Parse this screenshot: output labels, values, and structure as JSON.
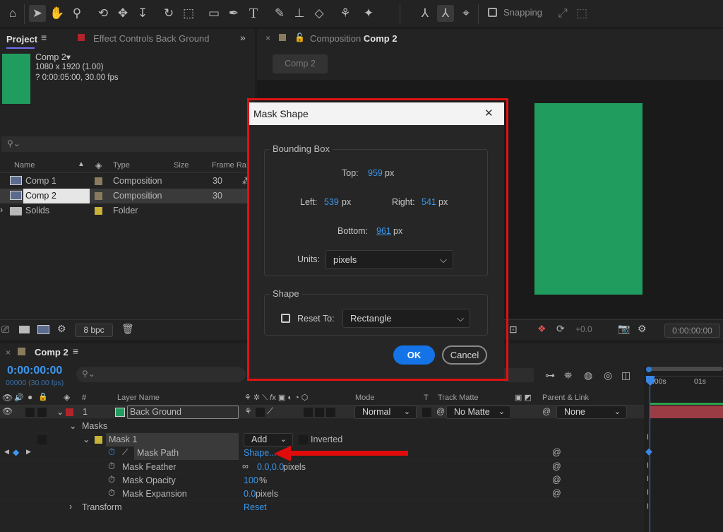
{
  "toolbar": {
    "snapping_label": "Snapping"
  },
  "project_panel": {
    "tab_project": "Project",
    "tab_effect_controls": "Effect Controls Back Ground",
    "comp_name": "Comp 2",
    "comp_resolution": "1080 x 1920 (1.00)",
    "comp_duration": "? 0:00:05:00, 30.00 fps",
    "search_placeholder": "",
    "columns": {
      "name": "Name",
      "type": "Type",
      "size": "Size",
      "frame_rate": "Frame Ra..."
    },
    "items": [
      {
        "name": "Comp 1",
        "type": "Composition",
        "fps": "30"
      },
      {
        "name": "Comp 2",
        "type": "Composition",
        "fps": "30"
      },
      {
        "name": "Solids",
        "type": "Folder",
        "fps": ""
      }
    ],
    "bpc": "8 bpc"
  },
  "comp_panel": {
    "tab_prefix": "Composition",
    "tab_name": "Comp 2",
    "sub_tab": "Comp 2",
    "exposure": "+0.0",
    "timecode": "0:00:00:00",
    "solid_color": "#219c5f"
  },
  "dialog": {
    "title": "Mask Shape",
    "bounding_box_label": "Bounding Box",
    "top_label": "Top:",
    "top_value": "959",
    "left_label": "Left:",
    "left_value": "539",
    "right_label": "Right:",
    "right_value": "541",
    "bottom_label": "Bottom:",
    "bottom_value": "961",
    "unit_px": "px",
    "units_label": "Units:",
    "units_value": "pixels",
    "shape_label": "Shape",
    "reset_to_label": "Reset To:",
    "reset_to_checked": false,
    "reset_to_value": "Rectangle",
    "ok_label": "OK",
    "cancel_label": "Cancel",
    "close_symbol": "✕"
  },
  "timeline": {
    "tab_name": "Comp 2",
    "timecode": "0:00:00:00",
    "frames": "00000 (30.00 fps)",
    "columns": {
      "layer_name": "Layer Name",
      "mode": "Mode",
      "t": "T",
      "track_matte": "Track Matte",
      "parent_link": "Parent & Link"
    },
    "layer": {
      "index": "1",
      "name": "Back Ground",
      "mode": "Normal",
      "matte": "No Matte",
      "parent": "None"
    },
    "masks_label": "Masks",
    "mask1": {
      "name": "Mask 1",
      "mode": "Add",
      "inverted": "Inverted"
    },
    "properties": [
      {
        "name": "Mask Path",
        "value": "Shape...",
        "unit": ""
      },
      {
        "name": "Mask Feather",
        "value": "0.0,0.0",
        "unit": " pixels"
      },
      {
        "name": "Mask Opacity",
        "value": "100",
        "unit": "%"
      },
      {
        "name": "Mask Expansion",
        "value": "0.0",
        "unit": " pixels"
      }
    ],
    "transform_label": "Transform",
    "reset_label": "Reset",
    "ruler": {
      "t0": "0:00s",
      "t1": "01s"
    }
  },
  "colors": {
    "accent": "#1473e6",
    "highlight": "#e00c0c",
    "link": "#3a98ef"
  }
}
